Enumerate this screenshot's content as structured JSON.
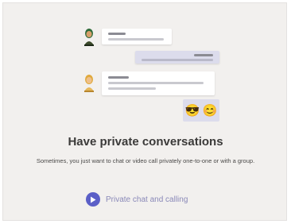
{
  "empty_state": {
    "title": "Have private conversations",
    "description": "Sometimes, you just want to chat or video call privately one-to-one or with a group.",
    "cta_label": "Private chat and calling",
    "cta_icon": "play-icon",
    "emojis": [
      "😎",
      "😊"
    ]
  },
  "colors": {
    "panel_bg": "#f2f0ee",
    "accent": "#5b5fc7",
    "outgoing_bubble": "#dcdcec"
  }
}
